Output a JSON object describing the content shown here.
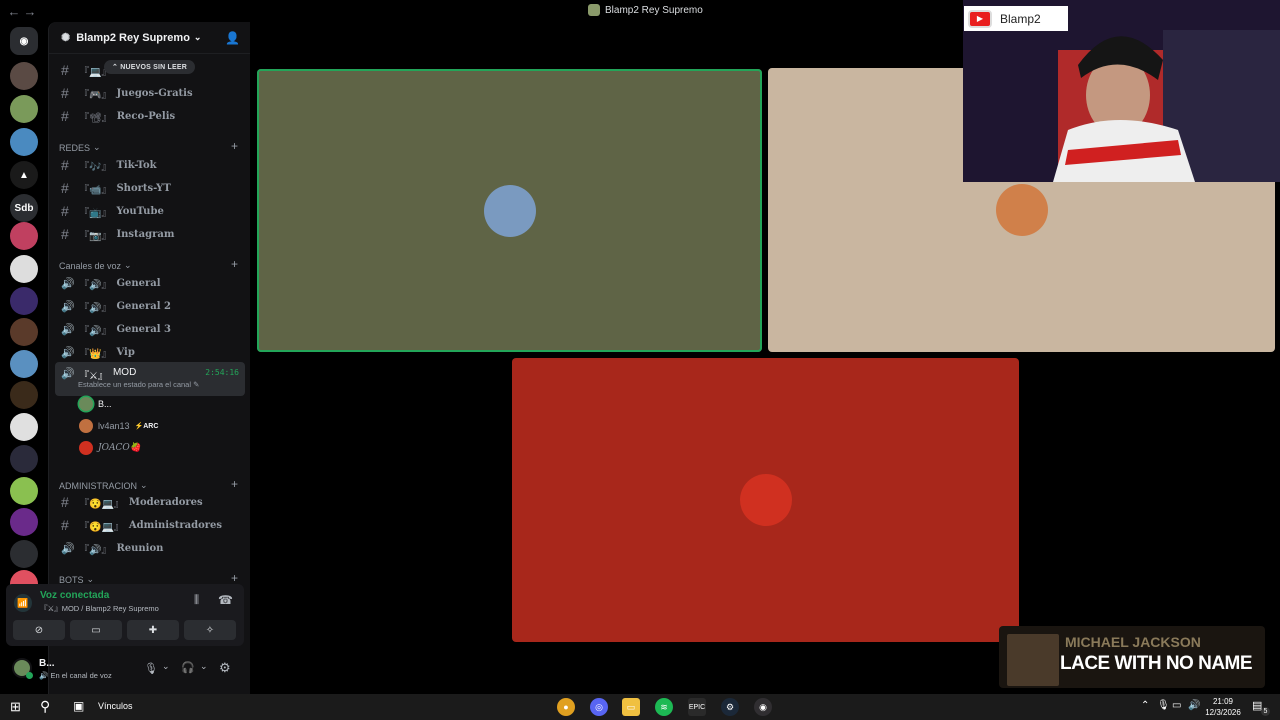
{
  "window": {
    "title": "Blamp2 Rey Supremo"
  },
  "servers": [
    {
      "name": "discord-home",
      "color": "#2b2d31",
      "label": "◉"
    },
    {
      "name": "server-1",
      "color": "#5a4a44",
      "label": ""
    },
    {
      "name": "server-2",
      "color": "#7a9a5a",
      "label": ""
    },
    {
      "name": "server-3",
      "color": "#4a8ac0",
      "label": ""
    },
    {
      "name": "server-4",
      "color": "#1a1a1a",
      "label": "▲"
    },
    {
      "name": "server-sdb",
      "color": "#2b2d31",
      "label": "Sdb"
    },
    {
      "name": "server-6",
      "color": "#c04060",
      "label": ""
    },
    {
      "name": "server-7",
      "color": "#dddddd",
      "label": ""
    },
    {
      "name": "server-8",
      "color": "#3a2a6a",
      "label": ""
    },
    {
      "name": "server-9",
      "color": "#5a3a2a",
      "label": ""
    },
    {
      "name": "server-10",
      "color": "#5a90c0",
      "label": ""
    },
    {
      "name": "server-11",
      "color": "#3a2a1a",
      "label": ""
    },
    {
      "name": "server-12",
      "color": "#e0e0e0",
      "label": ""
    },
    {
      "name": "server-13",
      "color": "#2a2a3a",
      "label": ""
    },
    {
      "name": "server-14",
      "color": "#8ac050",
      "label": ""
    },
    {
      "name": "server-15",
      "color": "#6a2a8a",
      "label": ""
    },
    {
      "name": "server-16",
      "color": "#2b2d31",
      "label": ""
    },
    {
      "name": "server-17",
      "color": "#e05060",
      "label": ""
    }
  ],
  "guild": {
    "name": "Blamp2 Rey Supremo",
    "unread_pill": "NUEVOS SIN LEER"
  },
  "channels_top": [
    {
      "emoji": "『💻』",
      "name": ""
    },
    {
      "emoji": "『🎮』",
      "name": "Juegos-Gratis"
    },
    {
      "emoji": "『📽』",
      "name": "Reco-Pelis"
    }
  ],
  "categories": {
    "redes": "REDES",
    "voz": "Canales de voz",
    "admin": "ADMINISTRACION",
    "bots": "BOTS"
  },
  "channels_redes": [
    {
      "emoji": "『🎶』",
      "name": "Tik-Tok"
    },
    {
      "emoji": "『📹』",
      "name": "Shorts-YT"
    },
    {
      "emoji": "『📺』",
      "name": "YouTube"
    },
    {
      "emoji": "『📷』",
      "name": "Instagram"
    }
  ],
  "channels_voz": [
    {
      "emoji": "『🔊』",
      "name": "General"
    },
    {
      "emoji": "『🔊』",
      "name": "General 2"
    },
    {
      "emoji": "『🔊』",
      "name": "General 3"
    },
    {
      "emoji": "『👑』",
      "name": "Vip"
    }
  ],
  "active_channel": {
    "emoji": "『⚔』",
    "name": "MOD",
    "timer": "2:54:16",
    "status_hint": "Establece un estado para el canal"
  },
  "voice_users": [
    {
      "name": "B...",
      "color": "#6a8a5a",
      "badge": ""
    },
    {
      "name": "lv4an13",
      "color": "#c07040",
      "badge": "⚡ARC"
    },
    {
      "name": "JOACO🍓",
      "color": "#d03020",
      "badge": ""
    }
  ],
  "channels_admin": [
    {
      "emoji": "『😯💻』",
      "name": "Moderadores",
      "type": "text"
    },
    {
      "emoji": "『😯💻』",
      "name": "Administradores",
      "type": "text"
    },
    {
      "emoji": "『🔊』",
      "name": "Reunion",
      "type": "voice"
    }
  ],
  "voice_panel": {
    "status": "Voz conectada",
    "location": "『⚔』MOD / Blamp2 Rey Supremo"
  },
  "user_panel": {
    "name": "B...",
    "status": "En el canal de voz"
  },
  "tiles": [
    {
      "name": "tile-user-1",
      "bg": "#5f6446",
      "avatar": "#7a9ac0",
      "speaking": true
    },
    {
      "name": "tile-user-2",
      "bg": "#c9b6a0",
      "avatar": "#d0804a",
      "speaking": false
    },
    {
      "name": "tile-user-3",
      "bg": "#a8271b",
      "avatar": "#d03020",
      "speaking": false
    }
  ],
  "overlay": {
    "channel_name": "Blamp2",
    "music_artist": "MICHAEL JACKSON",
    "music_title": "LACE WITH NO NAME"
  },
  "taskbar": {
    "search_label": "Vínculos",
    "time": "21:09",
    "date": "12/3/2026",
    "notif_count": "5"
  },
  "colors": {
    "speaking": "#23a559",
    "accent": "#5865f2"
  }
}
